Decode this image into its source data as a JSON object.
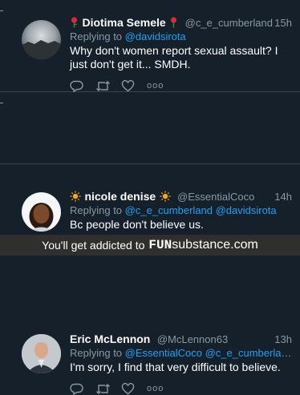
{
  "colors": {
    "background": "#15202b",
    "link": "#1da1f2",
    "muted": "#8899a6",
    "footer_bg": "#2f2f2f"
  },
  "tweets": [
    {
      "name": "Diotima Semele",
      "name_icon": "rose-icon",
      "handle": "@c_e_cumberland",
      "time": "15h",
      "reply_prefix": "Replying to",
      "reply_to": "@davidsirota",
      "text": "Why don't women report sexual assault? I just don't get it... SMDH."
    },
    {
      "name": "nicole denise",
      "name_icon": "sun-icon",
      "handle": "@EssentialCoco",
      "time": "14h",
      "reply_prefix": "Replying to",
      "reply_to": "@c_e_cumberland @davidsirota",
      "text": "Bc people don't believe us."
    },
    {
      "name": "Eric McLennon",
      "handle": "@McLennon63",
      "time": "13h",
      "reply_prefix": "Replying to",
      "reply_to": "@EssentialCoco @c_e_cumberland @da...",
      "text": "I'm sorry, I find that very difficult to believe."
    }
  ],
  "actions": {
    "icons": [
      "reply-icon",
      "retweet-icon",
      "like-icon",
      "more-icon"
    ],
    "more_label": "ooo"
  },
  "footer": {
    "text": "You'll get addicted to",
    "brand_a": "FUN",
    "brand_b": "substance",
    "brand_c": ".com"
  }
}
